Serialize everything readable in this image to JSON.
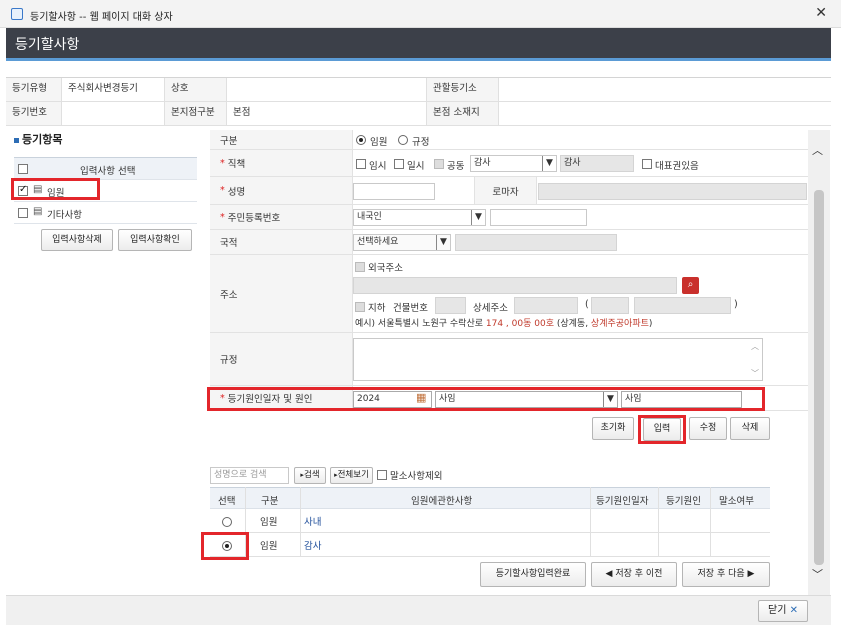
{
  "window": {
    "title": "등기할사항 -- 웹 페이지 대화 상자",
    "close_glyph": "✕"
  },
  "page": {
    "title": "등기할사항"
  },
  "info": {
    "row1": {
      "type_label": "등기유형",
      "type_value": "주식회사변경등기",
      "name_label": "상호",
      "name_value": "",
      "office_label": "관할등기소",
      "office_value": ""
    },
    "row2": {
      "no_label": "등기번호",
      "no_value": "",
      "branch_label": "본지점구분",
      "branch_value": "본점",
      "addr_label": "본점 소재지",
      "addr_value": ""
    }
  },
  "sidebar": {
    "title": "등기항목",
    "table_header": "입력사항 선택",
    "items": [
      {
        "label": "임원",
        "checked": true
      },
      {
        "label": "기타사항",
        "checked": false
      }
    ],
    "delete_button": "입력사항삭제",
    "confirm_button": "입력사항확인"
  },
  "form": {
    "category": {
      "label": "구분",
      "options": [
        "임원",
        "규정"
      ],
      "selected": "임원"
    },
    "position": {
      "label": "직책",
      "opt1": "임시",
      "opt2": "일시",
      "opt3": "공동",
      "select_value": "감사",
      "display_value": "감사",
      "rep_label": "대표권있음"
    },
    "name": {
      "label": "성명",
      "value": "",
      "roman_label": "로마자",
      "roman_value": ""
    },
    "resident": {
      "label": "주민등록번호",
      "select_value": "내국인",
      "value": ""
    },
    "nationality": {
      "label": "국적",
      "select_value": "선택하세요",
      "value": ""
    },
    "address": {
      "label": "주소",
      "foreign_label": "외국주소",
      "underground_label": "지하",
      "building_no_label": "건물번호",
      "detail_label": "상세주소",
      "paren_open": "(",
      "paren_close": ")",
      "example_prefix": "예시) 서울특별시 노원구 수락산로 ",
      "example_red1": "174 , 00동 00호",
      "example_mid": " (상계동, ",
      "example_red2": "상계주공아파트",
      "example_suffix": ")"
    },
    "regulation": {
      "label": "규정",
      "value": ""
    },
    "cause": {
      "label": "등기원인일자 및 원인",
      "date": "2024",
      "cause_select": "사임",
      "cause_text": "사임"
    }
  },
  "actions": {
    "reset": "초기화",
    "input": "입력",
    "edit": "수정",
    "delete": "삭제"
  },
  "search": {
    "placeholder": "성명으로 검색",
    "search_btn": "검색",
    "all_btn": "전체보기",
    "exclude_label": "말소사항제외"
  },
  "grid": {
    "headers": [
      "선택",
      "구분",
      "임원에관한사항",
      "등기원인일자",
      "등기원인",
      "말소여부"
    ],
    "rows": [
      {
        "selected": false,
        "category": "임원",
        "detail": "사내",
        "date": "",
        "cause": "",
        "status": ""
      },
      {
        "selected": true,
        "category": "임원",
        "detail": "감사",
        "date": "",
        "cause": "",
        "status": ""
      }
    ]
  },
  "nav": {
    "complete": "등기할사항입력완료",
    "prev": "저장 후 이전",
    "next": "저장 후 다음"
  },
  "footer": {
    "close": "닫기"
  },
  "colors": {
    "accent_red": "#e3262b",
    "header_dark": "#3c4049",
    "link_blue": "#1f4e9a"
  }
}
